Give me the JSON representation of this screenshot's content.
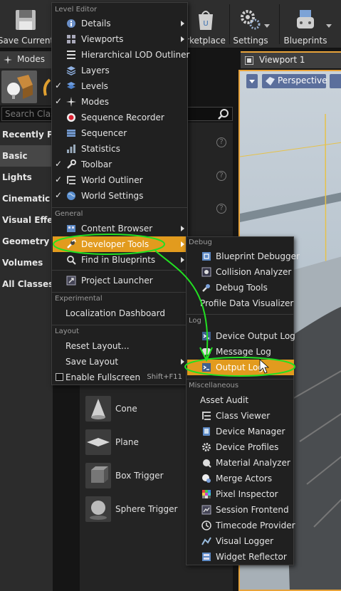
{
  "toolbar": {
    "save_current": "Save Current",
    "marketplace": "rketplace",
    "settings": "Settings",
    "blueprints": "Blueprints"
  },
  "modes": {
    "tab_label": "Modes",
    "search_placeholder": "Search Class",
    "categories": [
      "Recently Pla",
      "Basic",
      "Lights",
      "Cinematic",
      "Visual Effec",
      "Geometry",
      "Volumes",
      "All Classes"
    ],
    "placeables": [
      "Cone",
      "Plane",
      "Box Trigger",
      "Sphere Trigger"
    ]
  },
  "viewport": {
    "tab_label": "Viewport 1",
    "perspective": "Perspective"
  },
  "menu": {
    "level_editor_header": "Level Editor",
    "general_header": "General",
    "experimental_header": "Experimental",
    "layout_header": "Layout",
    "items": {
      "details": "Details",
      "viewports": "Viewports",
      "hlod": "Hierarchical LOD Outliner",
      "layers": "Layers",
      "levels": "Levels",
      "modes": "Modes",
      "sequence_recorder": "Sequence Recorder",
      "sequencer": "Sequencer",
      "statistics": "Statistics",
      "toolbar": "Toolbar",
      "world_outliner": "World Outliner",
      "world_settings": "World Settings",
      "content_browser": "Content Browser",
      "developer_tools": "Developer Tools",
      "find_in_blueprints": "Find in Blueprints",
      "project_launcher": "Project Launcher",
      "localization_dashboard": "Localization Dashboard",
      "reset_layout": "Reset Layout...",
      "save_layout": "Save Layout",
      "enable_fullscreen": "Enable Fullscreen",
      "fullscreen_shortcut": "Shift+F11"
    }
  },
  "submenu": {
    "debug_header": "Debug",
    "log_header": "Log",
    "misc_header": "Miscellaneous",
    "items": {
      "blueprint_debugger": "Blueprint Debugger",
      "collision_analyzer": "Collision Analyzer",
      "debug_tools": "Debug Tools",
      "profile_data_visualizer": "Profile Data Visualizer",
      "device_output_log": "Device Output Log",
      "message_log": "Message Log",
      "output_log": "Output Log",
      "asset_audit": "Asset Audit",
      "class_viewer": "Class Viewer",
      "device_manager": "Device Manager",
      "device_profiles": "Device Profiles",
      "material_analyzer": "Material Analyzer",
      "merge_actors": "Merge Actors",
      "pixel_inspector": "Pixel Inspector",
      "session_frontend": "Session Frontend",
      "timecode_provider": "Timecode Provider",
      "visual_logger": "Visual Logger",
      "widget_reflector": "Widget Reflector"
    }
  },
  "colors": {
    "highlight": "#e29b1e",
    "annotation": "#22e022",
    "viewport_border": "#e8a33a",
    "menu_bg": "#202020"
  }
}
